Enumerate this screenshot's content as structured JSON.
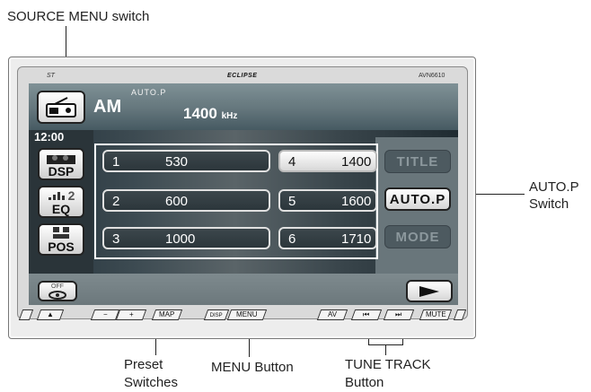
{
  "callouts": {
    "source_menu_switch": "SOURCE MENU switch",
    "autop_switch_line1": "AUTO.P",
    "autop_switch_line2": "Switch",
    "preset_line1": "Preset",
    "preset_line2": "Switches",
    "menu_button": "MENU Button",
    "tune_track_line1": "TUNE TRACK",
    "tune_track_line2": "Button"
  },
  "device": {
    "brand_left": "ST",
    "brand_center": "ECLIPSE",
    "model": "AVN6610"
  },
  "screen": {
    "band": "AM",
    "mode_indicator": "AUTO.P",
    "frequency": "1400",
    "frequency_unit": "kHz",
    "clock": "12:00",
    "side_buttons": {
      "dsp": "DSP",
      "eq": "EQ",
      "eq_level": "2",
      "pos": "POS",
      "off": "OFF"
    },
    "presets": [
      {
        "num": "1",
        "freq": "530"
      },
      {
        "num": "2",
        "freq": "600"
      },
      {
        "num": "3",
        "freq": "1000"
      },
      {
        "num": "4",
        "freq": "1400"
      },
      {
        "num": "5",
        "freq": "1600"
      },
      {
        "num": "6",
        "freq": "1710"
      }
    ],
    "active_preset": "4",
    "right_buttons": {
      "title": "TITLE",
      "autop": "AUTO.P",
      "mode": "MODE"
    }
  },
  "hardware_buttons": {
    "eject_glyph": "▲",
    "minus": "−",
    "plus": "+",
    "map": "MAP",
    "disp": "DISP",
    "menu": "MENU",
    "av": "AV",
    "prev": "⏮",
    "next": "⏭",
    "mute": "MUTE"
  },
  "colors": {
    "screen_dark": "#2a3439",
    "button_white": "#ffffff",
    "button_dark": "#4d5a60"
  }
}
